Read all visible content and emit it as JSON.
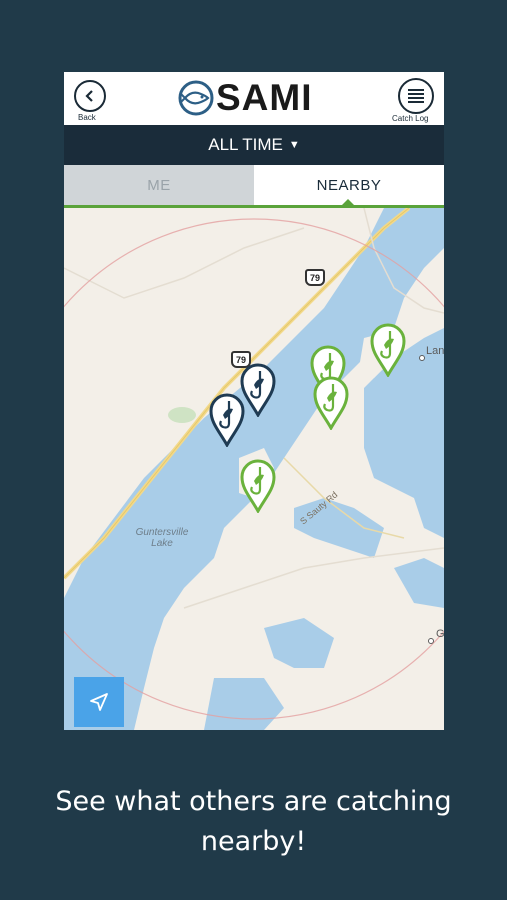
{
  "header": {
    "back_label": "Back",
    "logo_text": "SAMI",
    "catch_log_label": "Catch Log"
  },
  "filter": {
    "label": "ALL TIME"
  },
  "tabs": [
    {
      "label": "ME",
      "active": false
    },
    {
      "label": "NEARBY",
      "active": true
    }
  ],
  "map": {
    "lake_label": "Guntersville Lake",
    "road_label": "S Sauty Rd",
    "highway_shield": "79",
    "town_labels": [
      "Lan",
      "G"
    ],
    "pins": [
      {
        "type": "mine",
        "color": "#1f3b53"
      },
      {
        "type": "mine",
        "color": "#1f3b53"
      },
      {
        "type": "others",
        "color": "#6ab23c"
      },
      {
        "type": "others",
        "color": "#6ab23c"
      },
      {
        "type": "others",
        "color": "#6ab23c"
      },
      {
        "type": "others",
        "color": "#6ab23c"
      }
    ]
  },
  "colors": {
    "background": "#203a49",
    "header_bar": "#1a2c3a",
    "accent_green": "#5aa33a",
    "water": "#a9cde8",
    "land": "#f3efe8",
    "locate_button": "#4aa3e8"
  },
  "icons": [
    "back-icon",
    "fish-logo-icon",
    "list-icon",
    "caret-down-icon",
    "fish-hook-pin-icon",
    "location-arrow-icon"
  ],
  "caption": {
    "line1": "See what others are catching",
    "line2": "nearby!"
  }
}
